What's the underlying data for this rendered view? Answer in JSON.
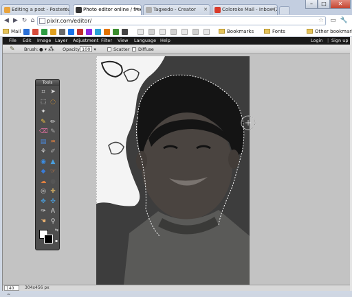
{
  "browser": {
    "tabs": [
      {
        "label": "Editing a post - Posterous",
        "favicon_color": "#e8a33d"
      },
      {
        "label": "Photo editor online / free...",
        "favicon_color": "#333333",
        "active": true
      },
      {
        "label": "Tagxedo - Creator",
        "favicon_color": "#b0b0b0"
      },
      {
        "label": "Coloroke Mail - Inbox (2) ...",
        "favicon_color": "#d93b2b"
      }
    ],
    "url": "pixlr.com/editor/",
    "window_controls": {
      "minimize": "–",
      "maximize": "□",
      "close": "✕"
    }
  },
  "bookmarks": {
    "items": [
      "Mail",
      "Bookmarks",
      "Fonts"
    ],
    "other": "Other bookmarks",
    "icon_colors": [
      "#2a6fd6",
      "#d64b3a",
      "#2f9e44",
      "#e0a020",
      "#6a6a6a",
      "#1a73e8",
      "#c03030",
      "#8a2be2",
      "#29a3d6",
      "#e37400",
      "#3c8d2f",
      "#444444"
    ]
  },
  "pixlr": {
    "menu": [
      "File",
      "Edit",
      "Image",
      "Layer",
      "Adjustment",
      "Filter",
      "View",
      "Language",
      "Help"
    ],
    "login": "Login",
    "signup": "Sign up",
    "options": {
      "brush_label": "Brush:",
      "opacity_label": "Opacity:",
      "opacity_value": "100",
      "scatter_label": "Scatter",
      "diffuse_label": "Diffuse"
    },
    "tools_title": "Tools",
    "tool_icons": [
      {
        "name": "crop-icon",
        "glyph": "⌗",
        "color": "#ddd"
      },
      {
        "name": "move-icon",
        "glyph": "➤",
        "color": "#ddd"
      },
      {
        "name": "marquee-icon",
        "glyph": "⬚",
        "color": "#ddd"
      },
      {
        "name": "lasso-icon",
        "glyph": "◌",
        "color": "#e8a030"
      },
      {
        "name": "wand-icon",
        "glyph": "✦",
        "color": "#ddd"
      },
      {
        "name": "blank-icon",
        "glyph": "",
        "color": "#ddd"
      },
      {
        "name": "pencil-icon",
        "glyph": "✎",
        "color": "#f0c040"
      },
      {
        "name": "brush-icon",
        "glyph": "✏",
        "color": "#ddd"
      },
      {
        "name": "eraser-icon",
        "glyph": "⌫",
        "color": "#e070a0"
      },
      {
        "name": "replace-color-icon",
        "glyph": "✎",
        "color": "#aaa"
      },
      {
        "name": "gradient-icon",
        "glyph": "▤",
        "color": "#4a8be0"
      },
      {
        "name": "paint-bucket-icon",
        "glyph": "♒",
        "color": "#e08040"
      },
      {
        "name": "clone-stamp-icon",
        "glyph": "⚘",
        "color": "#ddd"
      },
      {
        "name": "color-replace-icon",
        "glyph": "✐",
        "color": "#aaa"
      },
      {
        "name": "drawing-icon",
        "glyph": "◉",
        "color": "#3a8ee6"
      },
      {
        "name": "blur-icon",
        "glyph": "▲",
        "color": "#4aa0e0"
      },
      {
        "name": "sharpen-icon",
        "glyph": "◆",
        "color": "#3a7bd5"
      },
      {
        "name": "smudge-icon",
        "glyph": "☞",
        "color": "#e08040"
      },
      {
        "name": "sponge-icon",
        "glyph": "☁",
        "color": "#e08040"
      },
      {
        "name": "dodge-icon",
        "glyph": "●",
        "color": "#555"
      },
      {
        "name": "red-eye-icon",
        "glyph": "◎",
        "color": "#ddd"
      },
      {
        "name": "spot-heal-icon",
        "glyph": "✚",
        "color": "#c0a060"
      },
      {
        "name": "bloat-icon",
        "glyph": "✥",
        "color": "#4aa0e0"
      },
      {
        "name": "pinch-icon",
        "glyph": "✣",
        "color": "#4aa0e0"
      },
      {
        "name": "color-picker-icon",
        "glyph": "✑",
        "color": "#ddd"
      },
      {
        "name": "type-icon",
        "glyph": "A",
        "color": "#ddd"
      },
      {
        "name": "hand-icon",
        "glyph": "☚",
        "color": "#e8b070"
      },
      {
        "name": "zoom-icon",
        "glyph": "⚲",
        "color": "#ddd"
      }
    ],
    "status": {
      "zoom": "140 %",
      "dimensions": "304x456 px"
    }
  }
}
